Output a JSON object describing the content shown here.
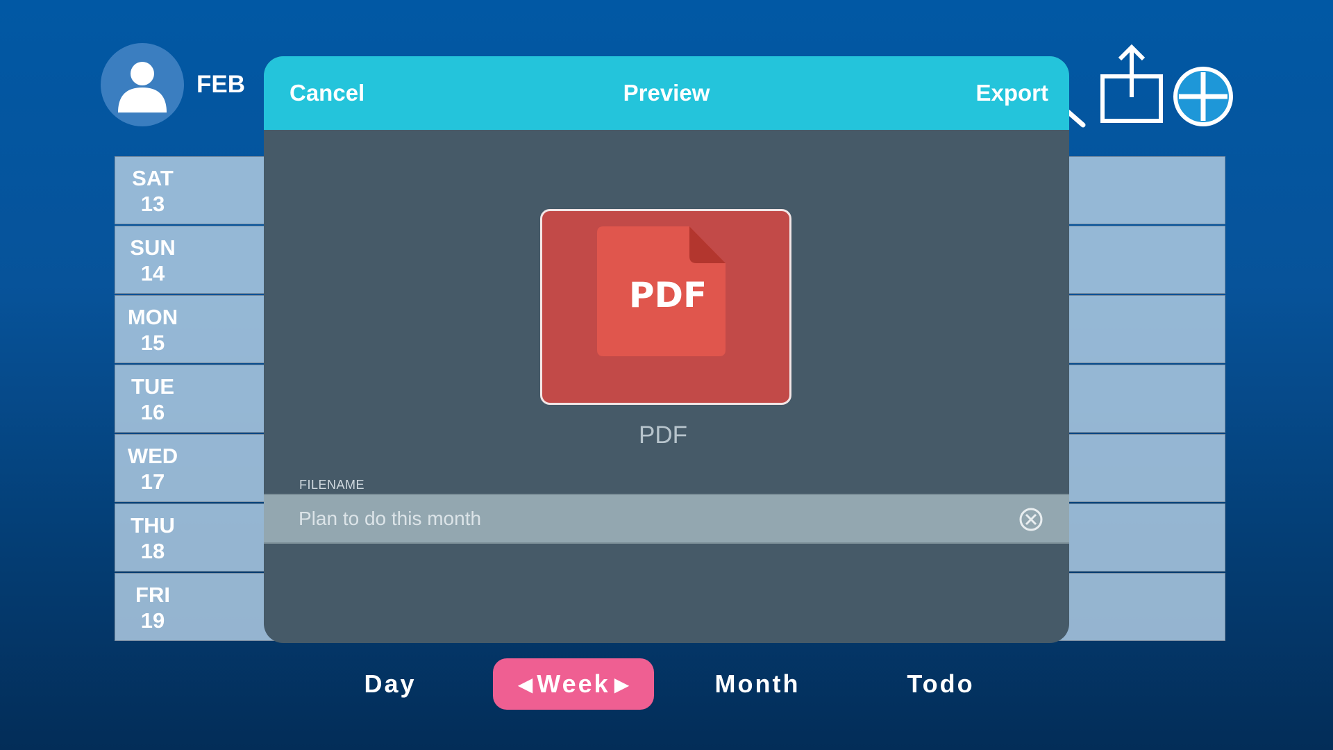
{
  "header": {
    "month": "FEB",
    "icons": [
      "avatar-icon",
      "search-icon",
      "share-icon",
      "add-icon"
    ]
  },
  "days": [
    {
      "weekday": "SAT",
      "date": "13"
    },
    {
      "weekday": "SUN",
      "date": "14"
    },
    {
      "weekday": "MON",
      "date": "15"
    },
    {
      "weekday": "TUE",
      "date": "16"
    },
    {
      "weekday": "WED",
      "date": "17"
    },
    {
      "weekday": "THU",
      "date": "18"
    },
    {
      "weekday": "FRI",
      "date": "19"
    }
  ],
  "nav": {
    "day": "Day",
    "week": "Week",
    "week_prev_arrow": "◀",
    "week_next_arrow": "▶",
    "month": "Month",
    "todo": "Todo",
    "active": "Week"
  },
  "modal": {
    "cancel_label": "Cancel",
    "title": "Preview",
    "export_label": "Export",
    "file_icon_text": "PDF",
    "format_label": "PDF",
    "filename_label": "FILENAME",
    "filename_value": "Plan to do this month",
    "clear_icon": "clear-icon"
  },
  "colors": {
    "background_top": "#0158a4",
    "background_bottom": "#032d58",
    "modal_header": "#24c4db",
    "modal_body": "#465a68",
    "active_tab": "#ef5f92",
    "pdf_card": "#c24a48",
    "pdf_doc": "#e0564d",
    "day_row": "#aac6de"
  }
}
